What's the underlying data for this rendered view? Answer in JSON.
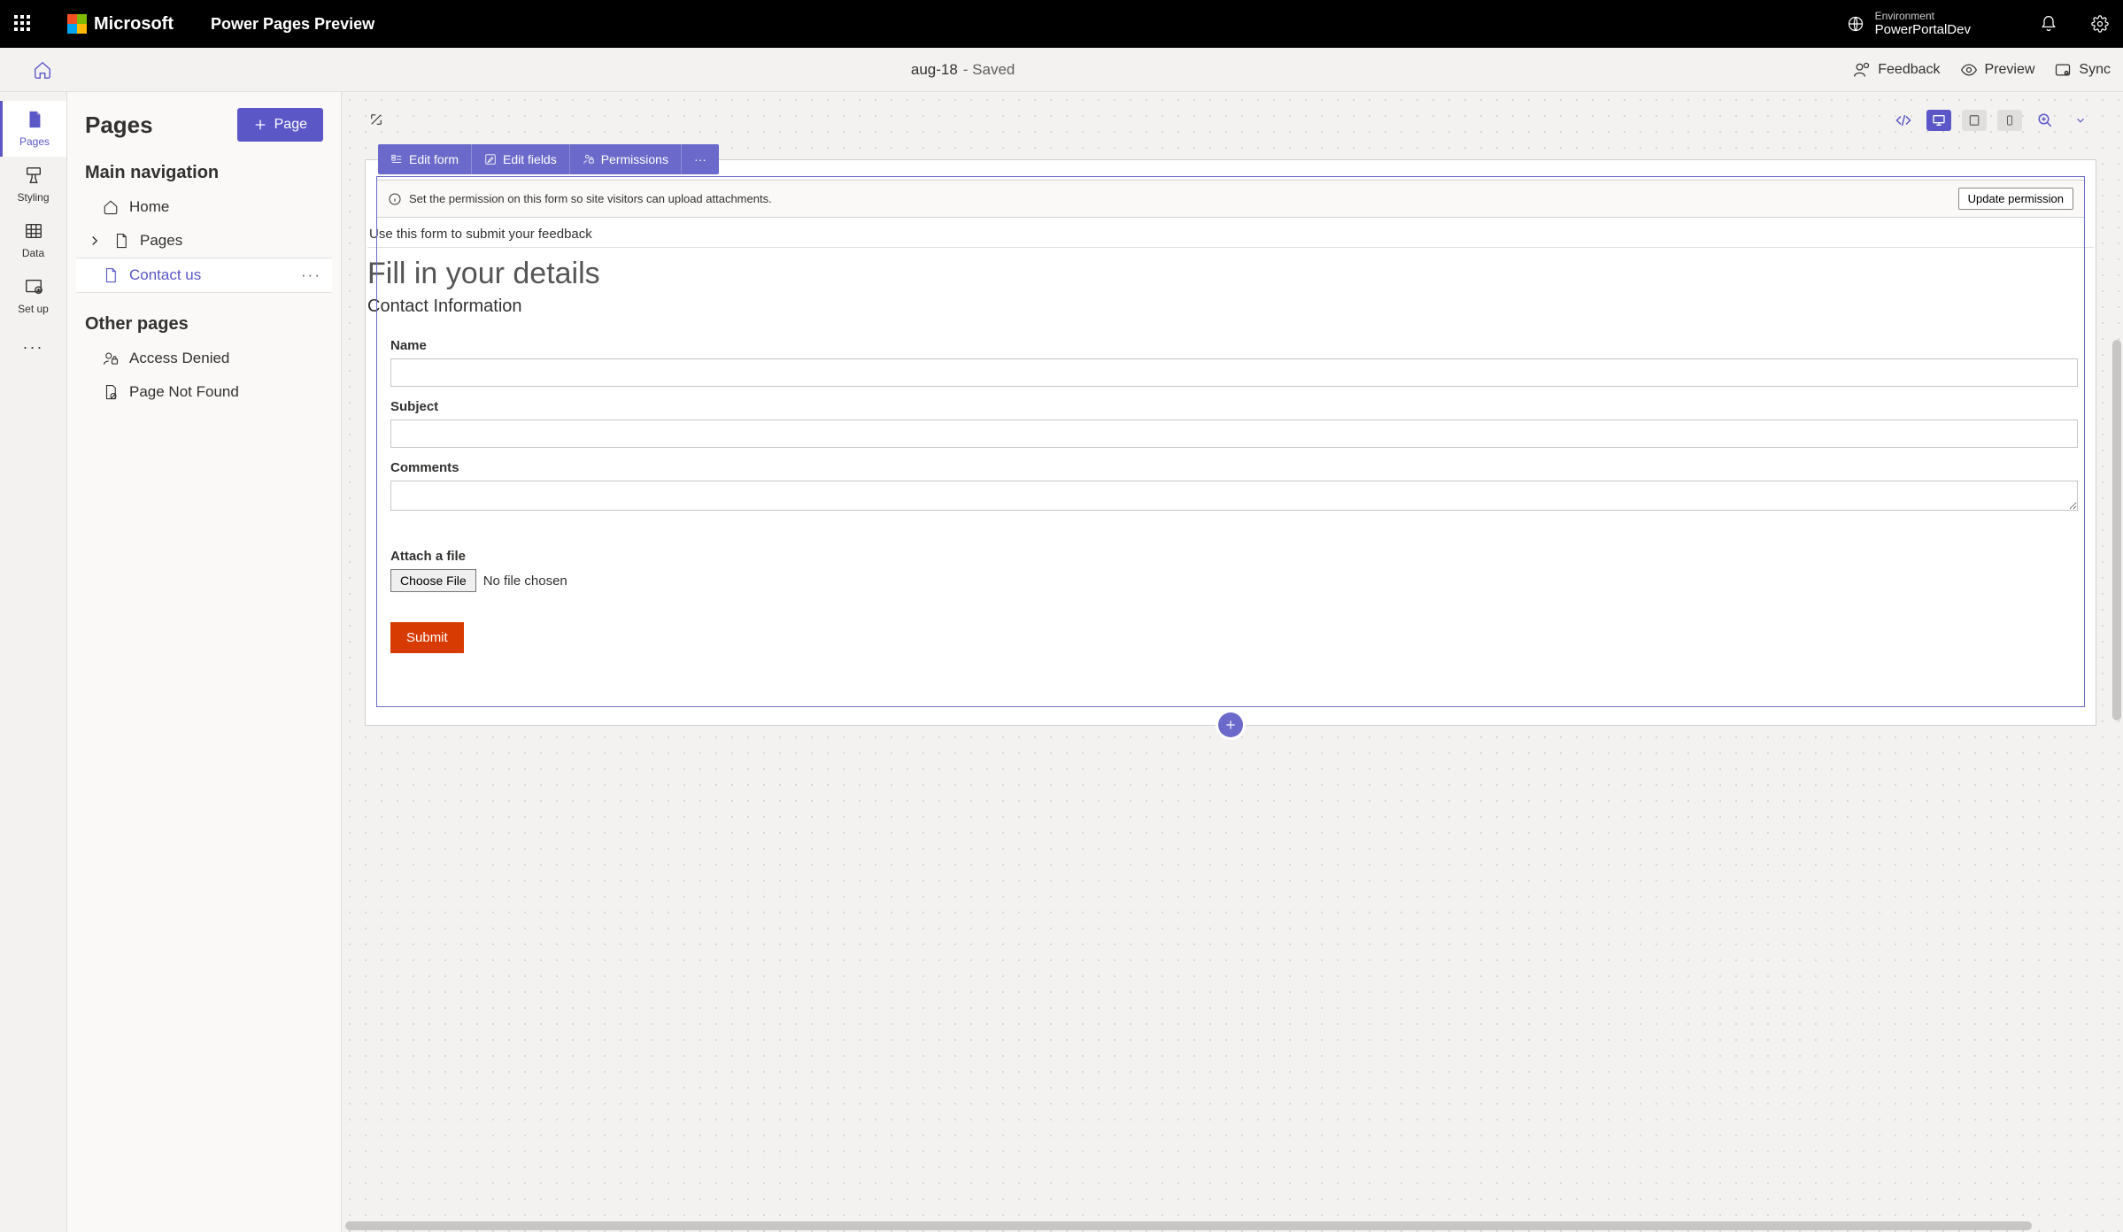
{
  "header": {
    "brand": "Microsoft",
    "app_name": "Power Pages Preview",
    "env_label": "Environment",
    "env_name": "PowerPortalDev"
  },
  "toolbar": {
    "site_name": "aug-18",
    "status": " - Saved",
    "feedback": "Feedback",
    "preview": "Preview",
    "sync": "Sync"
  },
  "rail": {
    "pages": "Pages",
    "styling": "Styling",
    "data": "Data",
    "setup": "Set up"
  },
  "panel": {
    "title": "Pages",
    "add_page": "Page",
    "main_nav": "Main navigation",
    "other_pages": "Other pages",
    "items_main": {
      "home": "Home",
      "pages": "Pages",
      "contact_us": "Contact us"
    },
    "items_other": {
      "access_denied": "Access Denied",
      "not_found": "Page Not Found"
    }
  },
  "form_toolbar": {
    "edit_form": "Edit form",
    "edit_fields": "Edit fields",
    "permissions": "Permissions"
  },
  "info_bar": {
    "message": "Set the permission on this form so site visitors can upload attachments.",
    "action": "Update permission"
  },
  "form": {
    "hint": "Use this form to submit your feedback",
    "title": "Fill in your details",
    "section": "Contact Information",
    "labels": {
      "name": "Name",
      "subject": "Subject",
      "comments": "Comments",
      "attach": "Attach a file"
    },
    "choose_file": "Choose File",
    "no_file": "No file chosen",
    "submit": "Submit"
  }
}
